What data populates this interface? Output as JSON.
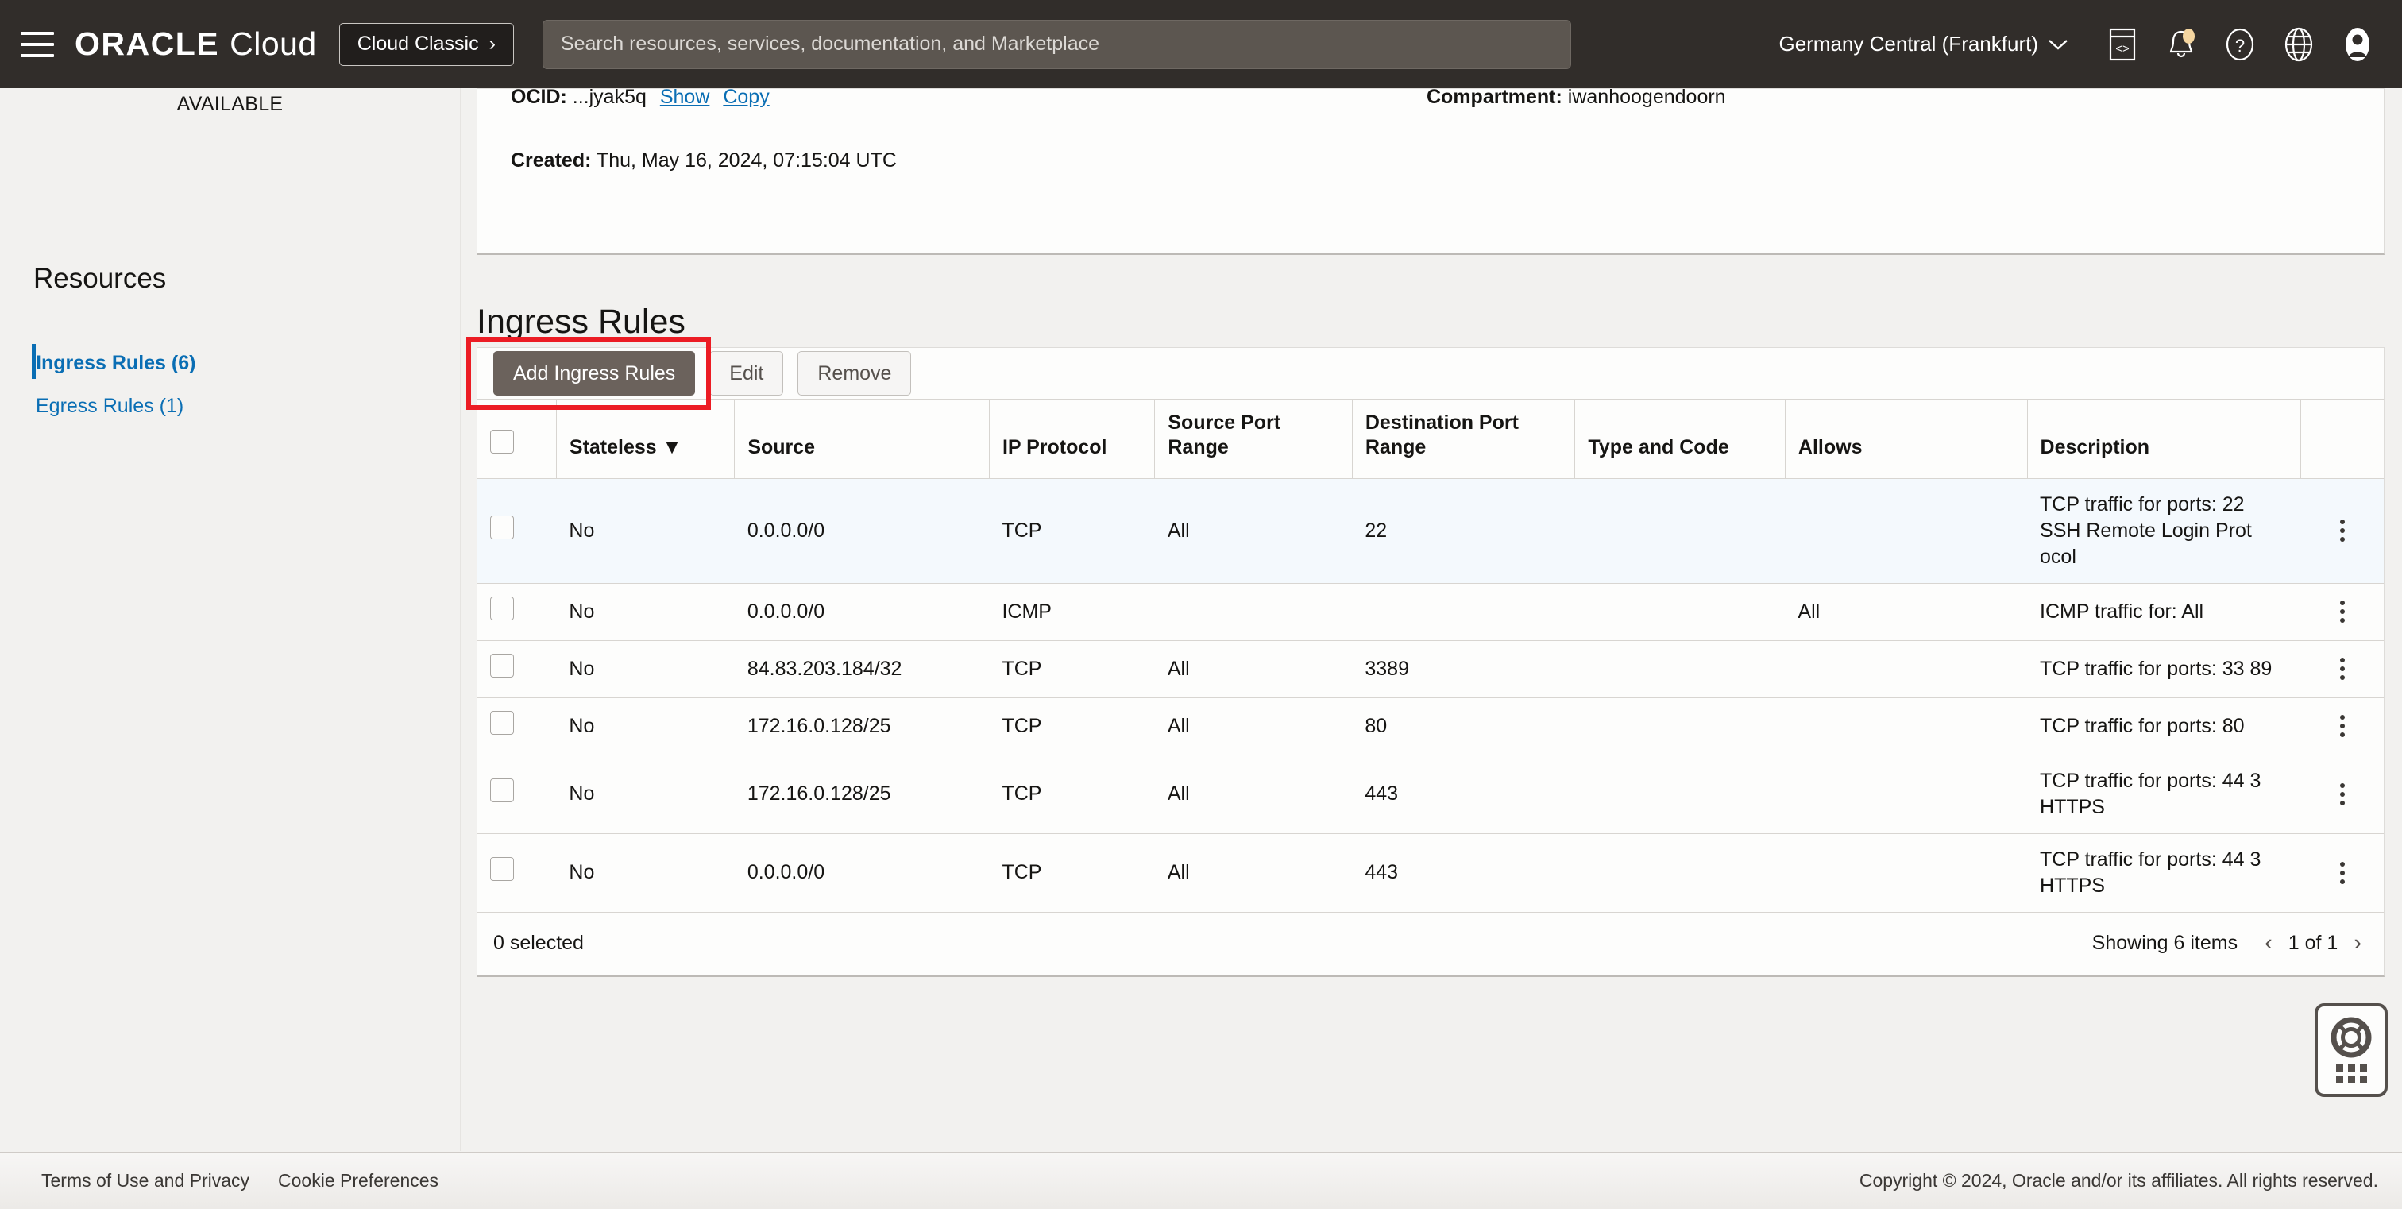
{
  "topnav": {
    "menu_icon": "hamburger-menu-icon",
    "brand_oracle": "ORACLE",
    "brand_cloud": "Cloud",
    "cloud_classic_label": "Cloud Classic",
    "cloud_classic_chevron": "›",
    "search_placeholder": "Search resources, services, documentation, and Marketplace",
    "search_value": "",
    "region": "Germany Central (Frankfurt)",
    "region_chevron": "⌄",
    "icons": [
      "code-editor-icon",
      "notifications-bell-icon",
      "help-question-icon",
      "language-globe-icon",
      "user-avatar-icon"
    ]
  },
  "sidebar": {
    "status": "AVAILABLE",
    "resources_title": "Resources",
    "items": [
      {
        "label": "Ingress Rules (6)",
        "active": true
      },
      {
        "label": "Egress Rules (1)",
        "active": false
      }
    ]
  },
  "detail_card": {
    "ocid_label": "OCID:",
    "ocid_value": "...jyak5q",
    "show_link": "Show",
    "copy_link": "Copy",
    "compartment_label": "Compartment:",
    "compartment_value": "iwanhoogendoorn",
    "created_label": "Created:",
    "created_value": "Thu, May 16, 2024, 07:15:04 UTC"
  },
  "page": {
    "title": "Ingress Rules"
  },
  "toolbar": {
    "add_label": "Add Ingress Rules",
    "edit_label": "Edit",
    "remove_label": "Remove",
    "highlight_color": "#ec1c24"
  },
  "table": {
    "headers": [
      "",
      "Stateless",
      "Source",
      "IP Protocol",
      "Source Port Range",
      "Destination Port Range",
      "Type and Code",
      "Allows",
      "Description",
      ""
    ],
    "sort_indicator": "▼",
    "rows": [
      {
        "stateless": "No",
        "source": "0.0.0.0/0",
        "protocol": "TCP",
        "source_port_range": "All",
        "destination_port_range": "22",
        "type_and_code": "",
        "allows": "",
        "description": "TCP traffic for ports: 22 SSH Remote Login Prot ocol",
        "highlighted": true
      },
      {
        "stateless": "No",
        "source": "0.0.0.0/0",
        "protocol": "ICMP",
        "source_port_range": "",
        "destination_port_range": "",
        "type_and_code": "",
        "allows": "All",
        "description": "ICMP traffic for: All",
        "highlighted": false
      },
      {
        "stateless": "No",
        "source": "84.83.203.184/32",
        "protocol": "TCP",
        "source_port_range": "All",
        "destination_port_range": "3389",
        "type_and_code": "",
        "allows": "",
        "description": "TCP traffic for ports: 33 89",
        "highlighted": false
      },
      {
        "stateless": "No",
        "source": "172.16.0.128/25",
        "protocol": "TCP",
        "source_port_range": "All",
        "destination_port_range": "80",
        "type_and_code": "",
        "allows": "",
        "description": "TCP traffic for ports: 80",
        "highlighted": false
      },
      {
        "stateless": "No",
        "source": "172.16.0.128/25",
        "protocol": "TCP",
        "source_port_range": "All",
        "destination_port_range": "443",
        "type_and_code": "",
        "allows": "",
        "description": "TCP traffic for ports: 44 3 HTTPS",
        "highlighted": false
      },
      {
        "stateless": "No",
        "source": "0.0.0.0/0",
        "protocol": "TCP",
        "source_port_range": "All",
        "destination_port_range": "443",
        "type_and_code": "",
        "allows": "",
        "description": "TCP traffic for ports: 44 3 HTTPS",
        "highlighted": false
      }
    ],
    "footer": {
      "selected": "0 selected",
      "showing": "Showing 6 items",
      "page_indicator": "1 of 1",
      "prev_arrow": "‹",
      "next_arrow": "›"
    }
  },
  "support_widget": {
    "icon": "life-ring-icon",
    "handle": "drag-handle-grid-icon"
  },
  "footer": {
    "terms": "Terms of Use and Privacy",
    "cookies": "Cookie Preferences",
    "copyright": "Copyright © 2024, Oracle and/or its affiliates. All rights reserved."
  }
}
